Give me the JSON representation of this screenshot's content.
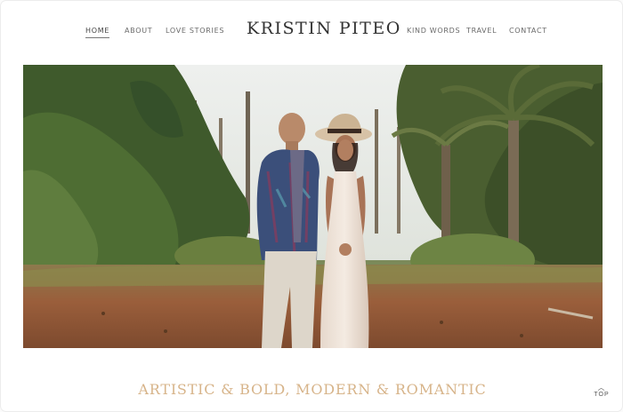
{
  "nav": {
    "left": [
      {
        "label": "HOME",
        "active": true
      },
      {
        "label": "ABOUT",
        "active": false
      },
      {
        "label": "LOVE STORIES",
        "active": false
      }
    ],
    "brand": "KRISTIN PITEO",
    "right": [
      {
        "label": "KIND WORDS"
      },
      {
        "label": "TRAVEL"
      },
      {
        "label": "CONTACT"
      }
    ]
  },
  "hero": {
    "image_subject": "couple-portrait-in-palm-forest"
  },
  "tagline": "ARTISTIC & BOLD, MODERN & ROMANTIC",
  "scroll_top": {
    "label": "TOP",
    "icon": "chevron-up-icon"
  },
  "colors": {
    "accent": "#d7b48a",
    "nav_text": "#6a6a6a",
    "brand_text": "#333333"
  }
}
